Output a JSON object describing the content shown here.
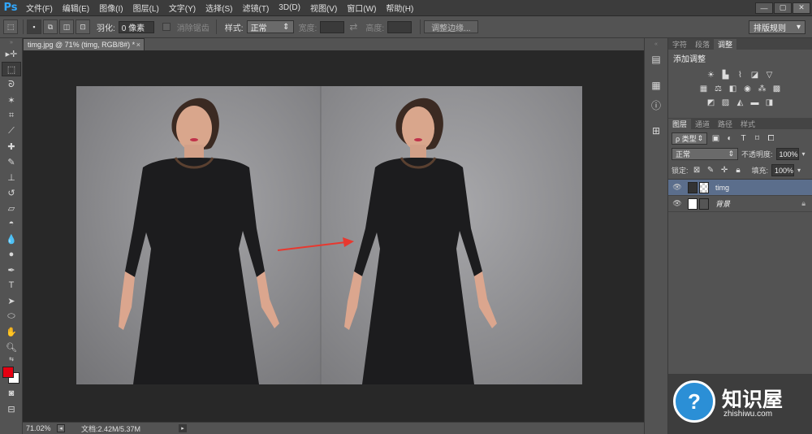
{
  "app": {
    "logo": "Ps"
  },
  "menu": [
    "文件(F)",
    "编辑(E)",
    "图像(I)",
    "图层(L)",
    "文字(Y)",
    "选择(S)",
    "滤镜(T)",
    "3D(D)",
    "视图(V)",
    "窗口(W)",
    "帮助(H)"
  ],
  "window_buttons": [
    "—",
    "▢",
    "✕"
  ],
  "options": {
    "feather_label": "羽化:",
    "feather_value": "0 像素",
    "antialias_label": "消除锯齿",
    "style_label": "样式:",
    "style_value": "正常",
    "width_label": "宽度:",
    "height_label": "高度:",
    "refine_button": "调整边缘...",
    "workspace": "排版规则"
  },
  "document": {
    "tab_title": "timg.jpg @ 71% (timg, RGB/8#) *"
  },
  "status": {
    "zoom": "71.02%",
    "doc_info": "文档:2.42M/5.37M"
  },
  "panels": {
    "top_tabs": [
      "字符",
      "段落",
      "调整"
    ],
    "adjust_title": "添加调整",
    "layer_tabs": [
      "图层",
      "通道",
      "路径",
      "样式"
    ],
    "filter_kind": "ρ 类型",
    "blend_mode": "正常",
    "opacity_label": "不透明度:",
    "opacity_value": "100%",
    "lock_label": "锁定:",
    "fill_label": "填充:",
    "fill_value": "100%",
    "layers": [
      {
        "name": "timg",
        "selected": true
      },
      {
        "name": "背景",
        "selected": false
      }
    ]
  },
  "watermark": {
    "title": "知识屋",
    "url": "zhishiwu.com"
  },
  "colors": {
    "foreground": "#e60012",
    "background": "#ffffff",
    "accent": "#31a8ff"
  }
}
